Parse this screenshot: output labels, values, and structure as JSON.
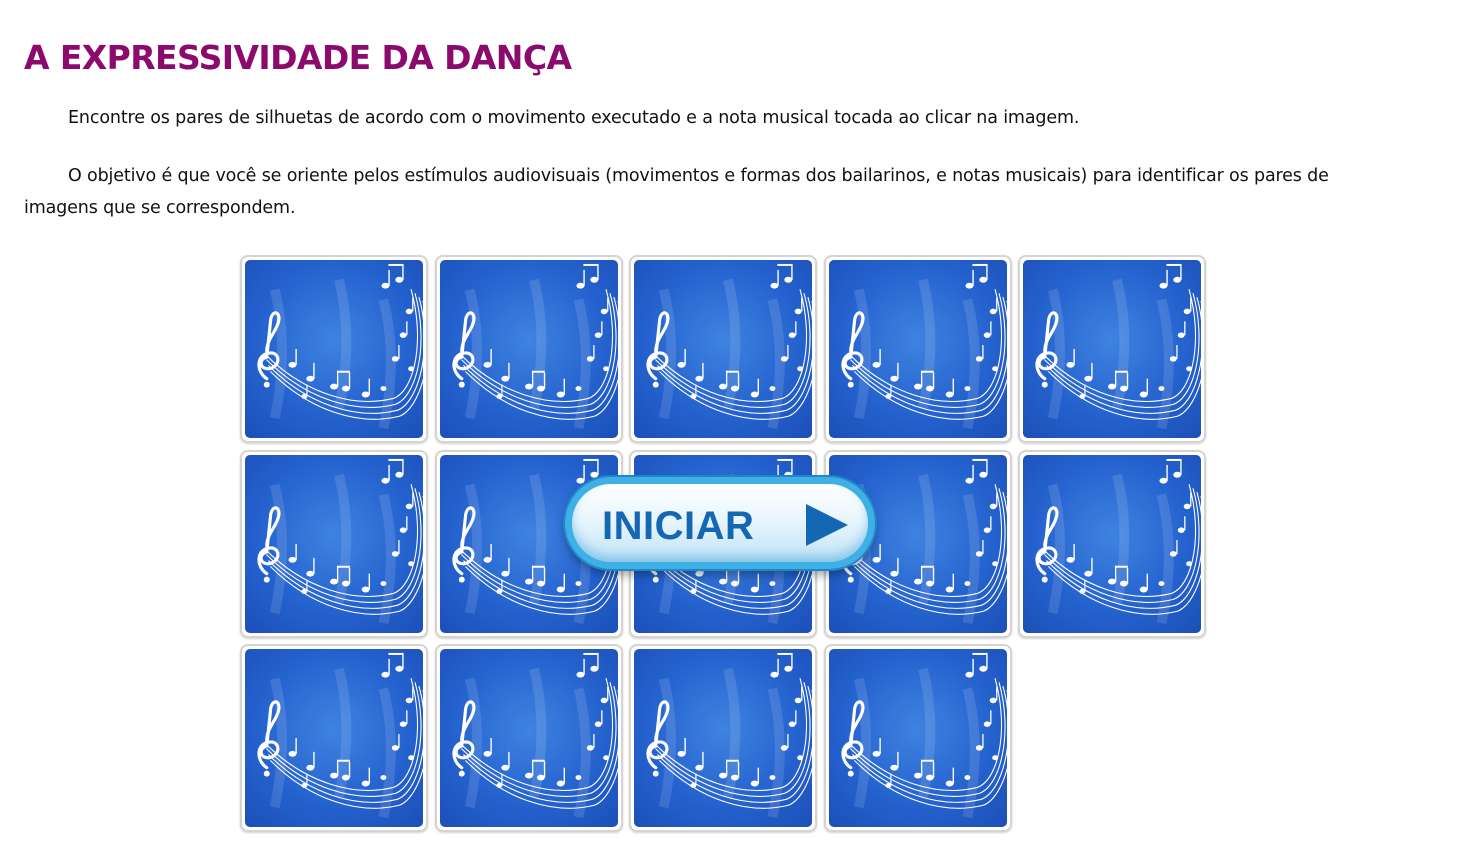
{
  "page": {
    "title": "A EXPRESSIVIDADE DA DANÇA",
    "paragraphs": [
      "Encontre os pares de silhuetas de acordo com o movimento executado e a nota musical tocada ao clicar na imagem.",
      "O objetivo é que você se oriente pelos estímulos audiovisuais (movimentos e formas dos bailarinos, e notas musicais) para identificar os pares de imagens que se correspondem."
    ]
  },
  "game": {
    "card_back_icon": "music-notes-icon",
    "card_count": 14,
    "start_button_label": "INICIAR",
    "start_button_icon": "play-triangle-icon",
    "colors": {
      "title": "#8c0a6e",
      "card_back": "#2563cf",
      "button_text": "#1367b3",
      "button_border": "#3fb0e6"
    }
  }
}
